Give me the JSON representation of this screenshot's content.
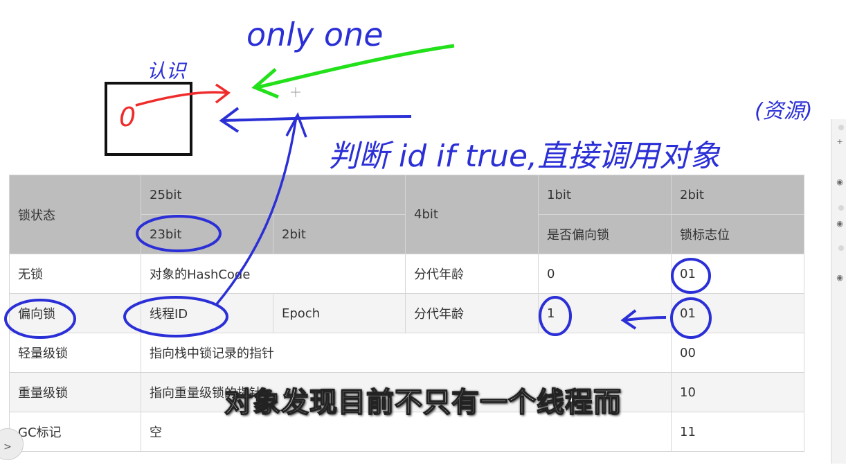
{
  "table": {
    "header_row1": [
      "锁状态",
      "25bit",
      "4bit",
      "1bit",
      "2bit"
    ],
    "header_row2": [
      "23bit",
      "2bit",
      "是否偏向锁",
      "锁标志位"
    ],
    "rows": [
      [
        "无锁",
        "对象的HashCode",
        "分代年龄",
        "0",
        "01"
      ],
      [
        "偏向锁",
        "线程ID",
        "Epoch",
        "分代年龄",
        "1",
        "01"
      ],
      [
        "轻量级锁",
        "指向栈中锁记录的指针",
        "00"
      ],
      [
        "重量级锁",
        "指向重量级锁的指针",
        "10"
      ],
      [
        "GC标记",
        "空",
        "11"
      ]
    ]
  },
  "annotations": {
    "only_one": "only one",
    "renshi": "认识",
    "zero": "0",
    "ziyuan": "(资源)",
    "judge": "判断 id  if  true,直接调用对象"
  },
  "subtitle": "对象发现目前不只有一个线程而",
  "colors": {
    "header_bg": "#bdbdbd",
    "ink_blue": "#2b2fd6",
    "ink_green": "#22e01a",
    "ink_red": "#ef2b2b"
  },
  "side_panel_icons": [
    "plus-icon",
    "eye-icon",
    "eye-icon",
    "eye-icon"
  ],
  "corner_icon": "share-icon"
}
